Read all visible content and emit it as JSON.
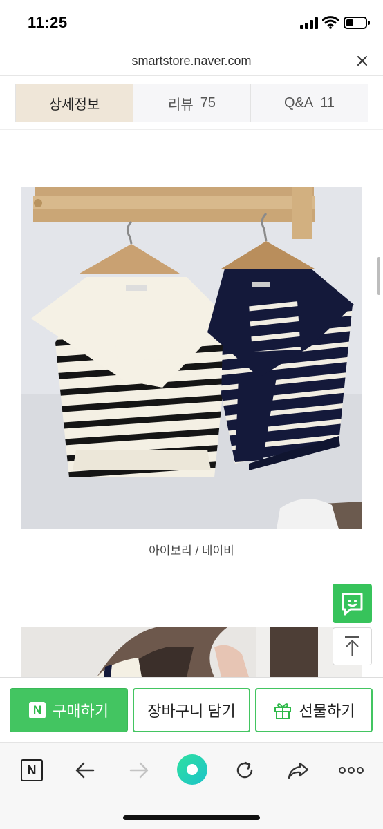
{
  "status_bar": {
    "time": "11:25"
  },
  "browser": {
    "url": "smartstore.naver.com"
  },
  "tabs": [
    {
      "label": "상세정보",
      "count": ""
    },
    {
      "label": "리뷰",
      "count": "75"
    },
    {
      "label": "Q&A",
      "count": "11"
    }
  ],
  "product": {
    "caption": "아이보리 / 네이비"
  },
  "purchase_bar": {
    "buy_badge": "N",
    "buy_label": "구매하기",
    "cart_label": "장바구니 담기",
    "gift_label": "선물하기"
  },
  "toolbar": {
    "n_button": "N"
  },
  "colors": {
    "accent": "#43c561",
    "active_tab_bg": "#efe6d8",
    "navy": "#14193a",
    "ivory": "#f4f0e4"
  }
}
